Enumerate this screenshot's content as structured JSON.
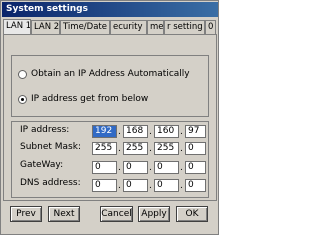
{
  "window": {
    "title": "System settings"
  },
  "tabs": [
    {
      "label": "LAN 1"
    },
    {
      "label": "LAN 2"
    },
    {
      "label": "Time/Date"
    },
    {
      "label": "ecurity"
    },
    {
      "label": "me"
    },
    {
      "label": "r setting"
    },
    {
      "label": "0"
    }
  ],
  "ip_mode": {
    "auto_label": "Obtain an IP Address Automatically",
    "manual_label": "IP address get from below",
    "selected": "manual"
  },
  "fields": [
    {
      "label": "IP address:",
      "octets": [
        "192",
        "168",
        "160",
        "97"
      ]
    },
    {
      "label": "Subnet Mask:",
      "octets": [
        "255",
        "255",
        "255",
        "0"
      ]
    },
    {
      "label": "GateWay:",
      "octets": [
        "0",
        "0",
        "0",
        "0"
      ]
    },
    {
      "label": "DNS address:",
      "octets": [
        "0",
        "0",
        "0",
        "0"
      ]
    }
  ],
  "buttons": {
    "prev": "Prev",
    "next": "Next",
    "cancel": "Cancel",
    "apply": "Apply",
    "ok": "OK"
  }
}
